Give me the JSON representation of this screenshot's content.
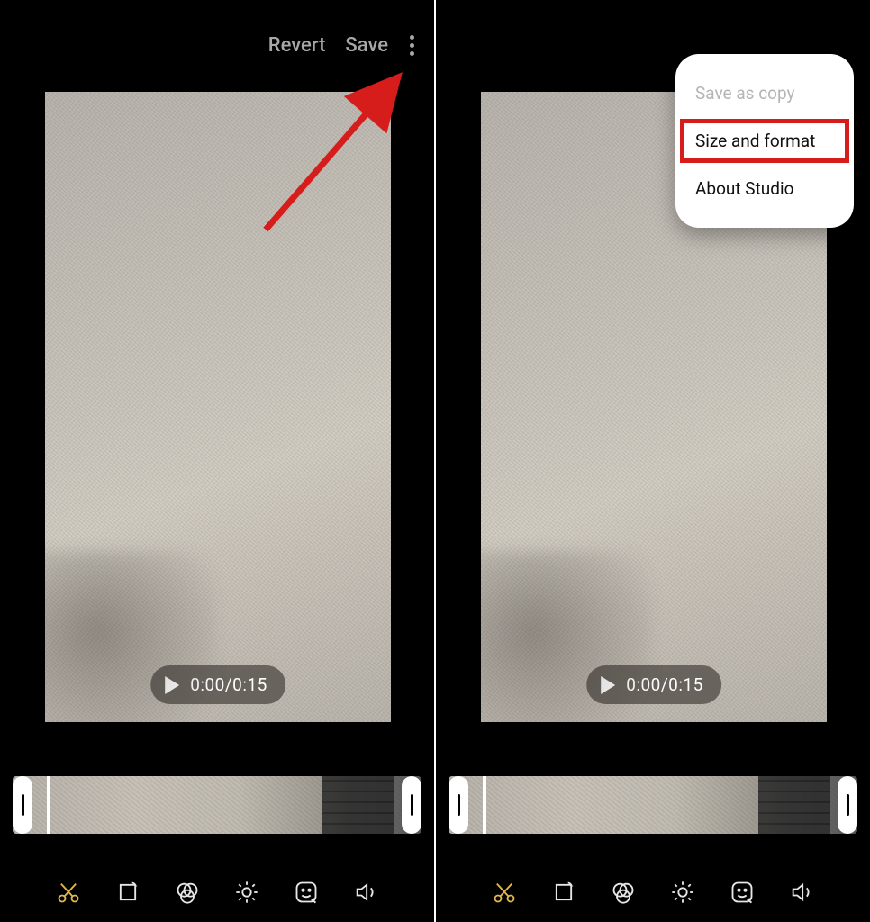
{
  "left": {
    "topbar": {
      "revert": "Revert",
      "save": "Save"
    },
    "player": {
      "time": "0:00/0:15"
    }
  },
  "right": {
    "player": {
      "time": "0:00/0:15"
    },
    "menu": {
      "save_copy": "Save as copy",
      "size_format": "Size and format",
      "about": "About Studio"
    }
  },
  "tools": {
    "trim": "trim",
    "crop": "crop",
    "filter": "filter",
    "adjust": "adjust",
    "sticker": "sticker",
    "audio": "audio"
  }
}
